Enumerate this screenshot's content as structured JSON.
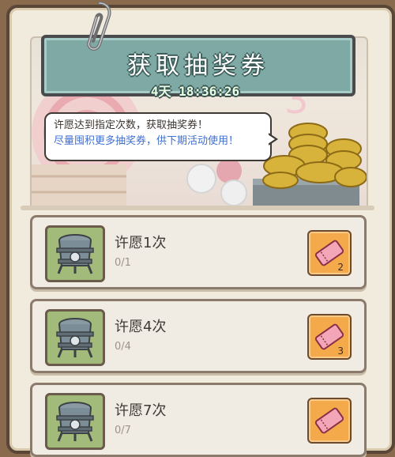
{
  "header": {
    "title": "获取抽奖券",
    "countdown": "4天 18:36:26"
  },
  "tip": {
    "line1": "许愿达到指定次数，获取抽奖券！",
    "line2": "尽量囤积更多抽奖券，供下期活动使用！"
  },
  "tasks": [
    {
      "name": "许愿1次",
      "progress": "0/1",
      "reward_count": "2",
      "icon": "wish-urn-icon",
      "reward_icon": "ticket-icon"
    },
    {
      "name": "许愿4次",
      "progress": "0/4",
      "reward_count": "3",
      "icon": "wish-urn-icon",
      "reward_icon": "ticket-icon"
    },
    {
      "name": "许愿7次",
      "progress": "0/7",
      "reward_count": "",
      "icon": "wish-urn-icon",
      "reward_icon": "ticket-icon"
    }
  ],
  "colors": {
    "banner": "#7ea9a4",
    "thumb_bg": "#a3bb7a",
    "reward_bg": "#f4a94a",
    "tip_highlight": "#3f6fd0"
  }
}
